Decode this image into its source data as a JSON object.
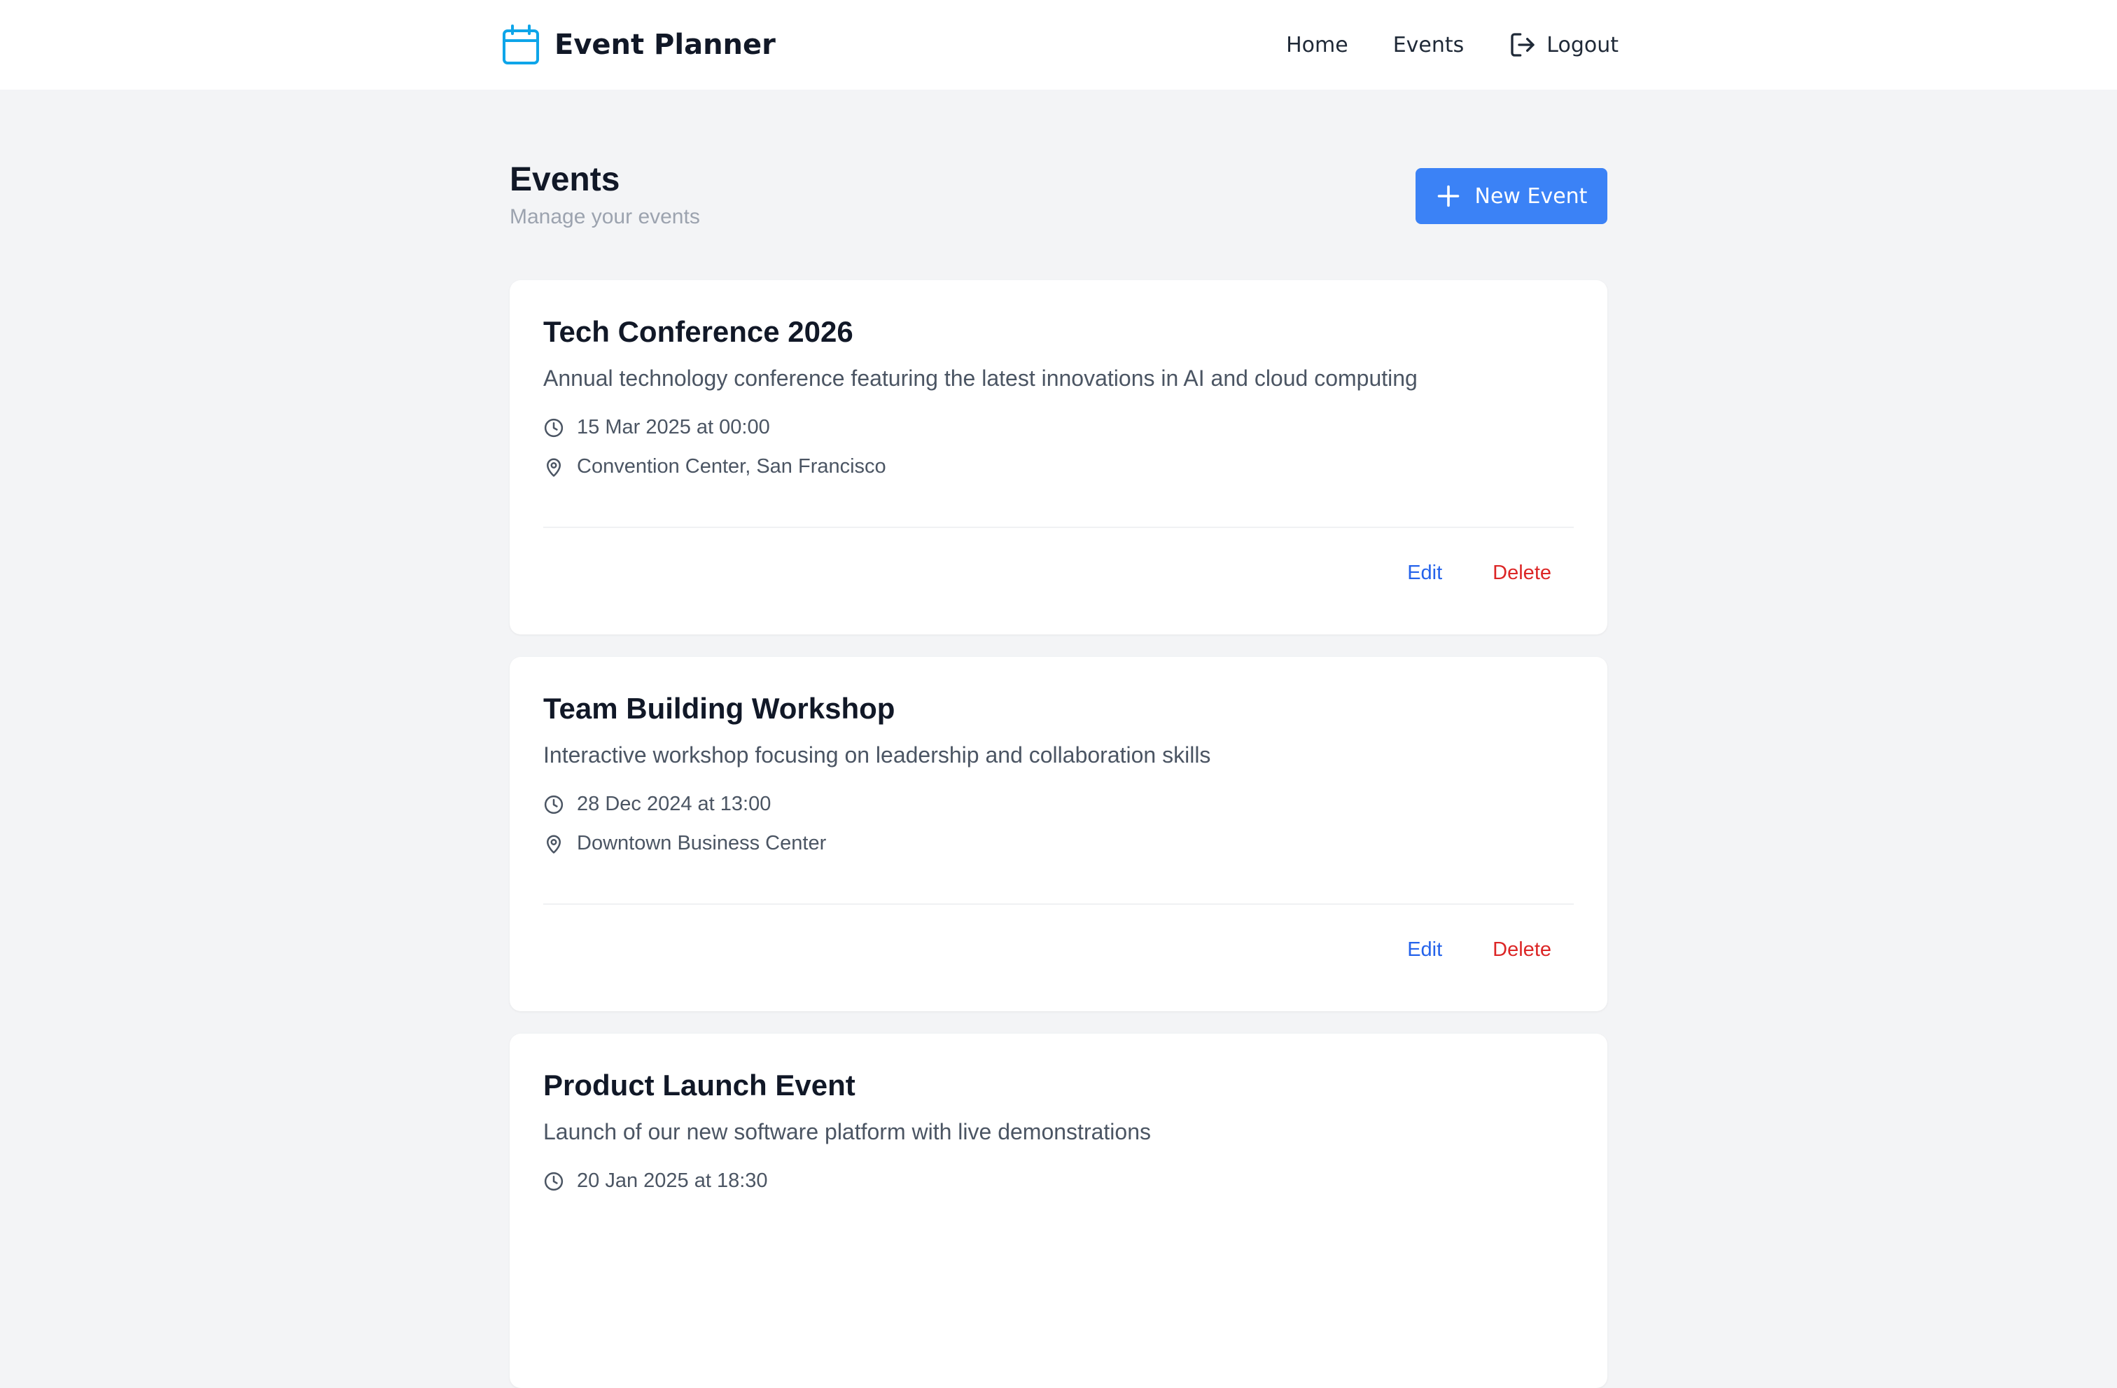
{
  "navbar": {
    "brand": "Event Planner",
    "links": [
      {
        "label": "Home"
      },
      {
        "label": "Events"
      },
      {
        "label": "Logout"
      }
    ]
  },
  "header": {
    "title": "Events",
    "subtitle": "Manage your events",
    "new_button": "New Event"
  },
  "events": [
    {
      "title": "Tech Conference 2026",
      "description": "Annual technology conference featuring the latest innovations in AI and cloud computing",
      "datetime": "15 Mar 2025 at 00:00",
      "location": "Convention Center, San Francisco",
      "edit": "Edit",
      "delete": "Delete"
    },
    {
      "title": "Team Building Workshop",
      "description": "Interactive workshop focusing on leadership and collaboration skills",
      "datetime": "28 Dec 2024 at 13:00",
      "location": "Downtown Business Center",
      "edit": "Edit",
      "delete": "Delete"
    },
    {
      "title": "Product Launch Event",
      "description": "Launch of our new software platform with live demonstrations",
      "datetime": "20 Jan 2025 at 18:30"
    }
  ],
  "colors": {
    "brand_icon": "#0ea5e9",
    "primary": "#3b82f6",
    "edit": "#2563eb",
    "delete": "#dc2626",
    "background": "#f3f4f6"
  }
}
